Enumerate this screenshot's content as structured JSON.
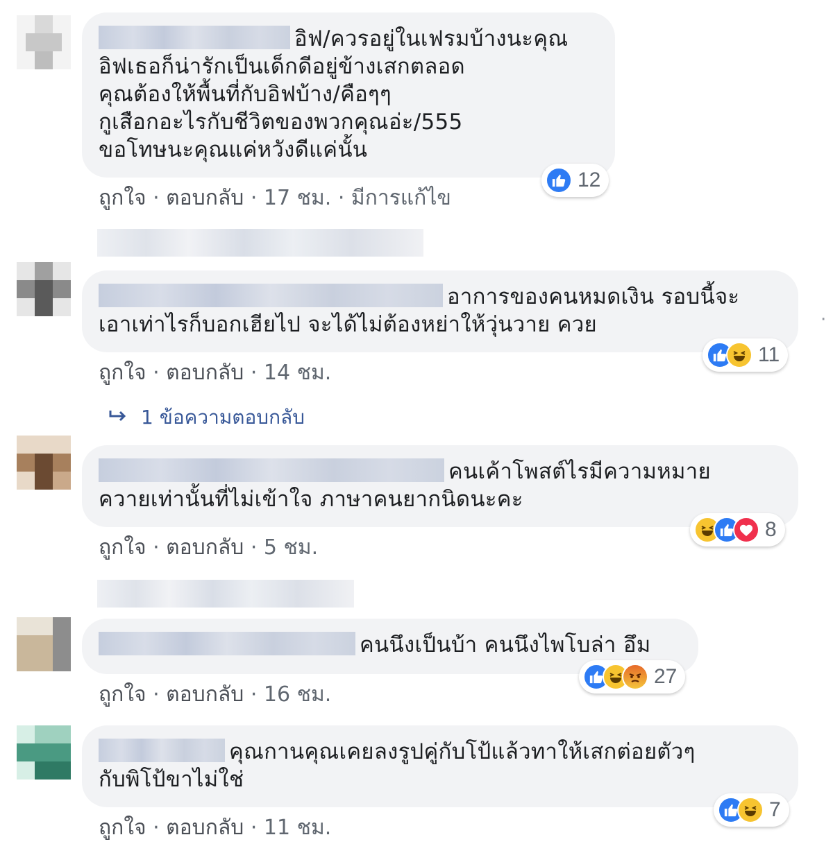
{
  "actions_labels": {
    "like": "ถูกใจ",
    "reply": "ตอบกลับ",
    "sep": " · "
  },
  "more_replies": "1 ข้อความตอบกลับ",
  "comments": [
    {
      "text": "อิฟ/ควรอยู่ในเฟรมบ้างนะคุณ\nอิฟเธอก็น่ารักเป็นเด็กดีอยู่ข้างเสกตลอด\nคุณต้องให้พื้นที่กับอิฟบ้าง/คือๆๆ\nกูเสือกอะไรกับชีวิตของพวกคุณอ่ะ/555\nขอโทษนะคุณแค่หวังดีแค่นั้น",
      "reactions": [
        "like"
      ],
      "reaction_count": "12",
      "time": "17 ชม.",
      "edited": "มีการแก้ไข"
    },
    {
      "text": "อาการของคนหมดเงิน รอบนี้จะ\nเอาเท่าไรก็บอกเฮียไป จะได้ไม่ต้องหย่าให้วุ่นวาย ควย",
      "reactions": [
        "like",
        "haha"
      ],
      "reaction_count": "11",
      "time": "14 ชม."
    },
    {
      "text": "คนเค้าโพสต์ไรมีความหมาย\nควายเท่านั้นที่ไม่เข้าใจ ภาษาคนยากนิดนะคะ",
      "reactions": [
        "haha",
        "like",
        "love"
      ],
      "reaction_count": "8",
      "time": "5 ชม."
    },
    {
      "text": "คนนึงเป็นบ้า คนนึงไพโบล่า อึม",
      "reactions": [
        "like",
        "haha",
        "angry"
      ],
      "reaction_count": "27",
      "time": "16 ชม."
    },
    {
      "text": "คุณกานคุณเคยลงรูปคู่กับโป้แล้วทาให้เสกต่อยตัวๆ\nกับพิโป้ขาไม่ใช่",
      "reactions": [
        "like",
        "haha"
      ],
      "reaction_count": "7",
      "time": "11 ชม."
    }
  ],
  "colors": {
    "bubble": "#f2f3f5",
    "link": "#385898",
    "meta": "#606770",
    "like": "#2d7bf4",
    "haha": "#f7c430",
    "love": "#f0304d"
  }
}
